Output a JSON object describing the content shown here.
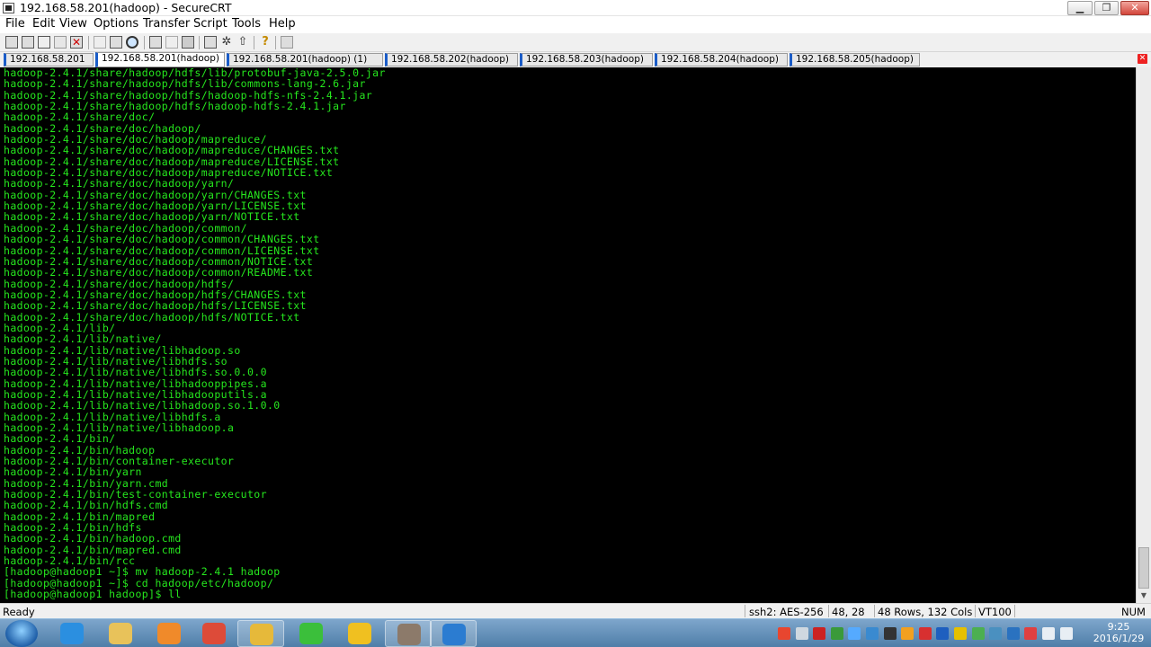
{
  "window": {
    "title": "192.168.58.201(hadoop) - SecureCRT",
    "min_glyph": "▁",
    "max_glyph": "❐",
    "close_glyph": "✕"
  },
  "menu": [
    "File",
    "Edit",
    "View",
    "Options",
    "Transfer",
    "Script",
    "Tools",
    "Help"
  ],
  "toolbar_icons": [
    "connect-icon",
    "quick-connect-icon",
    "connect-tab-icon",
    "reconnect-icon",
    "disconnect-icon",
    "copy-icon",
    "paste-icon",
    "find-icon",
    "print-setup-icon",
    "print-icon",
    "printer-icon",
    "session-options-icon",
    "global-options-icon",
    "sftp-icon",
    "help-icon",
    "keymap-icon"
  ],
  "tabs": [
    {
      "label": "192.168.58.201",
      "active": false
    },
    {
      "label": "192.168.58.201(hadoop)",
      "active": true
    },
    {
      "label": "192.168.58.201(hadoop) (1)",
      "active": false
    },
    {
      "label": "192.168.58.202(hadoop)",
      "active": false
    },
    {
      "label": "192.168.58.203(hadoop)",
      "active": false
    },
    {
      "label": "192.168.58.204(hadoop)",
      "active": false
    },
    {
      "label": "192.168.58.205(hadoop)",
      "active": false
    }
  ],
  "terminal": {
    "fg_color": "#26e81e",
    "bg_color": "#000000",
    "lines": [
      "hadoop-2.4.1/share/hadoop/hdfs/lib/protobuf-java-2.5.0.jar",
      "hadoop-2.4.1/share/hadoop/hdfs/lib/commons-lang-2.6.jar",
      "hadoop-2.4.1/share/hadoop/hdfs/hadoop-hdfs-nfs-2.4.1.jar",
      "hadoop-2.4.1/share/hadoop/hdfs/hadoop-hdfs-2.4.1.jar",
      "hadoop-2.4.1/share/doc/",
      "hadoop-2.4.1/share/doc/hadoop/",
      "hadoop-2.4.1/share/doc/hadoop/mapreduce/",
      "hadoop-2.4.1/share/doc/hadoop/mapreduce/CHANGES.txt",
      "hadoop-2.4.1/share/doc/hadoop/mapreduce/LICENSE.txt",
      "hadoop-2.4.1/share/doc/hadoop/mapreduce/NOTICE.txt",
      "hadoop-2.4.1/share/doc/hadoop/yarn/",
      "hadoop-2.4.1/share/doc/hadoop/yarn/CHANGES.txt",
      "hadoop-2.4.1/share/doc/hadoop/yarn/LICENSE.txt",
      "hadoop-2.4.1/share/doc/hadoop/yarn/NOTICE.txt",
      "hadoop-2.4.1/share/doc/hadoop/common/",
      "hadoop-2.4.1/share/doc/hadoop/common/CHANGES.txt",
      "hadoop-2.4.1/share/doc/hadoop/common/LICENSE.txt",
      "hadoop-2.4.1/share/doc/hadoop/common/NOTICE.txt",
      "hadoop-2.4.1/share/doc/hadoop/common/README.txt",
      "hadoop-2.4.1/share/doc/hadoop/hdfs/",
      "hadoop-2.4.1/share/doc/hadoop/hdfs/CHANGES.txt",
      "hadoop-2.4.1/share/doc/hadoop/hdfs/LICENSE.txt",
      "hadoop-2.4.1/share/doc/hadoop/hdfs/NOTICE.txt",
      "hadoop-2.4.1/lib/",
      "hadoop-2.4.1/lib/native/",
      "hadoop-2.4.1/lib/native/libhadoop.so",
      "hadoop-2.4.1/lib/native/libhdfs.so",
      "hadoop-2.4.1/lib/native/libhdfs.so.0.0.0",
      "hadoop-2.4.1/lib/native/libhadooppipes.a",
      "hadoop-2.4.1/lib/native/libhadooputils.a",
      "hadoop-2.4.1/lib/native/libhadoop.so.1.0.0",
      "hadoop-2.4.1/lib/native/libhdfs.a",
      "hadoop-2.4.1/lib/native/libhadoop.a",
      "hadoop-2.4.1/bin/",
      "hadoop-2.4.1/bin/hadoop",
      "hadoop-2.4.1/bin/container-executor",
      "hadoop-2.4.1/bin/yarn",
      "hadoop-2.4.1/bin/yarn.cmd",
      "hadoop-2.4.1/bin/test-container-executor",
      "hadoop-2.4.1/bin/hdfs.cmd",
      "hadoop-2.4.1/bin/mapred",
      "hadoop-2.4.1/bin/hdfs",
      "hadoop-2.4.1/bin/hadoop.cmd",
      "hadoop-2.4.1/bin/mapred.cmd",
      "hadoop-2.4.1/bin/rcc",
      "[hadoop@hadoop1 ~]$ mv hadoop-2.4.1 hadoop",
      "[hadoop@hadoop1 ~]$ cd hadoop/etc/hadoop/",
      "[hadoop@hadoop1 hadoop]$ ll"
    ]
  },
  "status": {
    "ready": "Ready",
    "cipher": "ssh2: AES-256",
    "cursor": "48,  28",
    "size": "48 Rows, 132 Cols",
    "emulation": "VT100",
    "num": "NUM"
  },
  "taskbar": {
    "apps": [
      {
        "name": "ie-icon",
        "color": "#2b8fe0",
        "open": false
      },
      {
        "name": "explorer-icon",
        "color": "#e8c25a",
        "open": false
      },
      {
        "name": "media-player-icon",
        "color": "#f08a2a",
        "open": false
      },
      {
        "name": "chrome-icon",
        "color": "#dd4b39",
        "open": false
      },
      {
        "name": "file-transfer-icon",
        "color": "#e6b93a",
        "open": true
      },
      {
        "name": "green-app-icon",
        "color": "#3bbf3b",
        "open": false
      },
      {
        "name": "e-app-icon",
        "color": "#f0c020",
        "open": false
      },
      {
        "name": "card-app-icon",
        "color": "#8c7a6a",
        "open": true
      },
      {
        "name": "securecrt-icon",
        "color": "#2b7cd1",
        "open": true
      }
    ],
    "tray": [
      {
        "name": "sogou-icon",
        "color": "#e8462f"
      },
      {
        "name": "moon-icon",
        "color": "#cfd8e0"
      },
      {
        "name": "red-app-icon",
        "color": "#cc2222"
      },
      {
        "name": "network-app-icon",
        "color": "#3a9a3a"
      },
      {
        "name": "cloud-icon",
        "color": "#55aaff"
      },
      {
        "name": "shield-icon",
        "color": "#3a8ad0"
      },
      {
        "name": "qq-icon",
        "color": "#333333"
      },
      {
        "name": "qq2-icon",
        "color": "#f2a020"
      },
      {
        "name": "red-cross-icon",
        "color": "#d83030"
      },
      {
        "name": "bluetooth-icon",
        "color": "#1e5fbf"
      },
      {
        "name": "plus-icon",
        "color": "#e6c000"
      },
      {
        "name": "security-shield-icon",
        "color": "#4caf50"
      },
      {
        "name": "monitor-icon",
        "color": "#4a90c0"
      },
      {
        "name": "sync-icon",
        "color": "#2a72c0"
      },
      {
        "name": "flag-icon",
        "color": "#e04040"
      },
      {
        "name": "speaker-icon",
        "color": "#e8eef4"
      },
      {
        "name": "signal-icon",
        "color": "#e8eef4"
      }
    ],
    "time": "9:25",
    "date": "2016/1/29"
  }
}
